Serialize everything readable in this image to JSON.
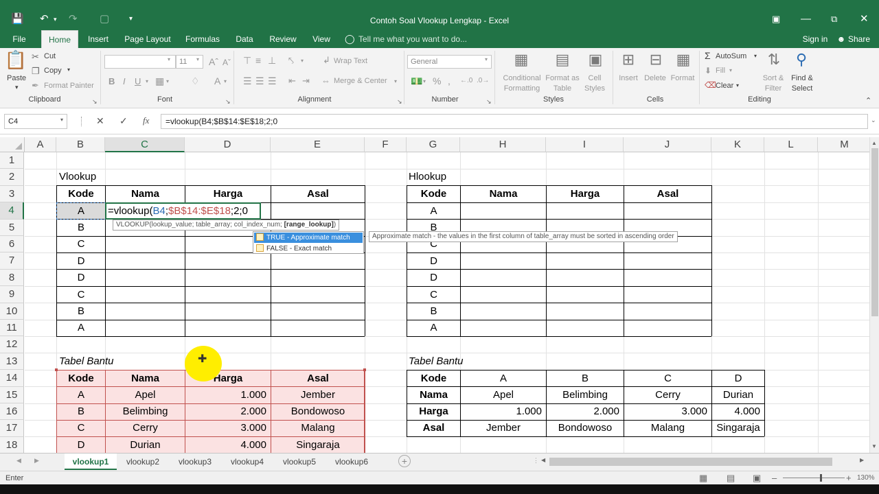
{
  "window": {
    "title": "Contoh Soal Vlookup Lengkap - Excel",
    "sign_in": "Sign in",
    "share": "Share"
  },
  "tabs": [
    "File",
    "Home",
    "Insert",
    "Page Layout",
    "Formulas",
    "Data",
    "Review",
    "View"
  ],
  "tell_me": "Tell me what you want to do...",
  "ribbon": {
    "paste": "Paste",
    "cut": "Cut",
    "copy": "Copy",
    "format_painter": "Format Painter",
    "font_size": "11",
    "wrap_text": "Wrap Text",
    "merge_center": "Merge & Center",
    "number_format": "General",
    "conditional_formatting": [
      "Conditional",
      "Formatting"
    ],
    "format_as_table": [
      "Format as",
      "Table"
    ],
    "cell_styles": [
      "Cell",
      "Styles"
    ],
    "insert": "Insert",
    "delete": "Delete",
    "format": "Format",
    "autosum": "AutoSum",
    "fill": "Fill",
    "clear": "Clear",
    "sort_filter": [
      "Sort &",
      "Filter"
    ],
    "find_select": [
      "Find &",
      "Select"
    ],
    "groups": [
      "Clipboard",
      "Font",
      "Alignment",
      "Number",
      "Styles",
      "Cells",
      "Editing"
    ]
  },
  "formula_bar": {
    "name_box": "C4",
    "formula": "=vlookup(B4;$B$14:$E$18;2;0"
  },
  "columns": [
    "A",
    "B",
    "C",
    "D",
    "E",
    "F",
    "G",
    "H",
    "I",
    "J",
    "K",
    "L",
    "M"
  ],
  "rows": [
    "1",
    "2",
    "3",
    "4",
    "5",
    "6",
    "7",
    "8",
    "9",
    "10",
    "11",
    "12",
    "13",
    "14",
    "15",
    "16",
    "17",
    "18"
  ],
  "vlookup": {
    "title": "Vlookup",
    "headers": [
      "Kode",
      "Nama",
      "Harga",
      "Asal"
    ],
    "codes": [
      "A",
      "B",
      "C",
      "D",
      "D",
      "C",
      "B",
      "A"
    ],
    "edit_parts": [
      "=vlookup(",
      "B4",
      ";",
      "$B$14:$E$18",
      ";2;0"
    ]
  },
  "hlookup": {
    "title": "Hlookup",
    "headers": [
      "Kode",
      "Nama",
      "Harga",
      "Asal"
    ],
    "codes": [
      "A",
      "B",
      "C",
      "D",
      "D",
      "C",
      "B",
      "A"
    ]
  },
  "tabel_bantu_v": {
    "title": "Tabel Bantu",
    "headers": [
      "Kode",
      "Nama",
      "Harga",
      "Asal"
    ],
    "rows": [
      [
        "A",
        "Apel",
        "1.000",
        "Jember"
      ],
      [
        "B",
        "Belimbing",
        "2.000",
        "Bondowoso"
      ],
      [
        "C",
        "Cerry",
        "3.000",
        "Malang"
      ],
      [
        "D",
        "Durian",
        "4.000",
        "Singaraja"
      ]
    ]
  },
  "tabel_bantu_h": {
    "title": "Tabel Bantu",
    "labels": [
      "Kode",
      "Nama",
      "Harga",
      "Asal"
    ],
    "cols": [
      [
        "A",
        "Apel",
        "1.000",
        "Jember"
      ],
      [
        "B",
        "Belimbing",
        "2.000",
        "Bondowoso"
      ],
      [
        "C",
        "Cerry",
        "3.000",
        "Malang"
      ],
      [
        "D",
        "Durian",
        "4.000",
        "Singaraja"
      ]
    ]
  },
  "autocomplete": {
    "syntax_prefix": "VLOOKUP(lookup_value; table_array; col_index_num; ",
    "syntax_bold": "[range_lookup]",
    "syntax_suffix": ")",
    "options": [
      "TRUE - Approximate match",
      "FALSE - Exact match"
    ],
    "description": "Approximate match - the values in the first column of table_array must be sorted in ascending order"
  },
  "sheets": [
    "vlookup1",
    "vlookup2",
    "vlookup3",
    "vlookup4",
    "vlookup5",
    "vlookup6"
  ],
  "status": {
    "mode": "Enter",
    "zoom": "130%"
  },
  "colors": {
    "excel_green": "#217346",
    "pink_fill": "#fbe2e2",
    "pink_border": "#c0504d",
    "highlight_yellow": "#ffee00"
  }
}
